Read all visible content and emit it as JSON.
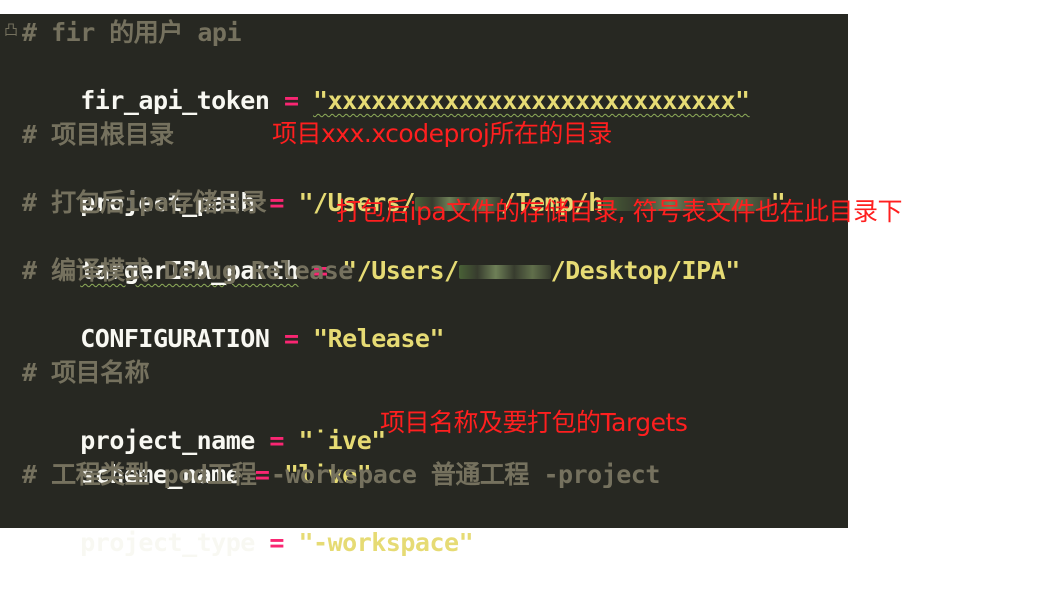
{
  "editor": {
    "fold_marker": "凸",
    "lines": {
      "c1": "# fir 的用户 api",
      "fir_key": "fir_api_token",
      "fir_val": "\"xxxxxxxxxxxxxxxxxxxxxxxxxxxx\"",
      "c2": "# 项目根目录",
      "proj_key": "project_path",
      "proj_val_a": "\"/Users/",
      "proj_val_b": "/Temp/h",
      "proj_val_c": "\"",
      "c3": "# 打包后ipa存储目录",
      "ipa_key": "targerIPA_parth",
      "ipa_val_a": "\"/Users/",
      "ipa_val_b": "/Desktop/IPA\"",
      "c4": "# 编译模式 Debug Release",
      "conf_key": "CONFIGURATION",
      "conf_val": "\"Release\"",
      "c5": "# 项目名称",
      "pname_key": "project_name",
      "pname_val": "\"˙ive\"",
      "sname_key": "scheme_name",
      "sname_val": "\"l˙ve\"",
      "c6": "# 工程类型 pod工程 -workspace 普通工程 -project",
      "ptype_key": "project_type",
      "ptype_val": "\"-workspace\"",
      "eq": " = "
    }
  },
  "annotations": {
    "a1": "项目xxx.xcodeproj所在的目录",
    "a2": "打包后ipa文件的存储目录, 符号表文件也在此目录下",
    "a3": "项目名称及要打包的Targets"
  }
}
